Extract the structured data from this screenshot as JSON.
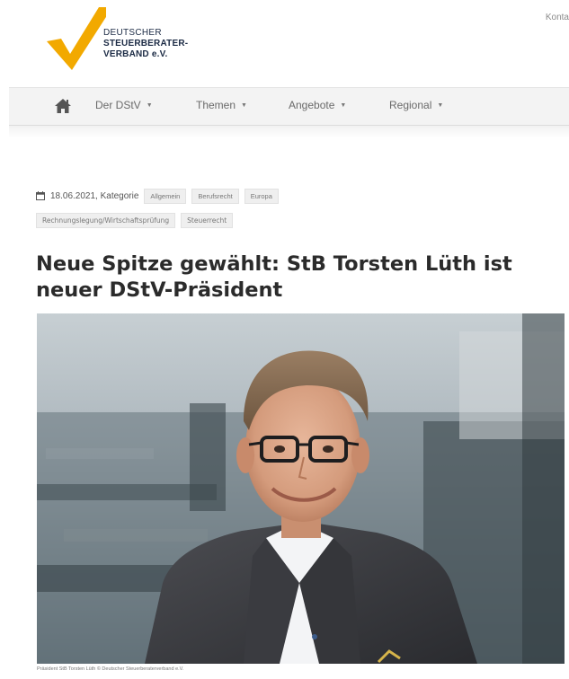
{
  "brand": {
    "logo_line1": "DEUTSCHER",
    "logo_line2": "STEUERBERATER-",
    "logo_line3": "VERBAND e.V.",
    "accent_color": "#f2a900",
    "text_color": "#1b2a44"
  },
  "top_link": "Konta",
  "nav": {
    "home_icon": "home-icon",
    "items": [
      {
        "label": "Der DStV"
      },
      {
        "label": "Themen"
      },
      {
        "label": "Angebote"
      },
      {
        "label": "Regional"
      }
    ]
  },
  "article": {
    "date": "18.06.2021, Kategorie",
    "tags_line1": [
      "Allgemein",
      "Berufsrecht",
      "Europa"
    ],
    "tags_line2": [
      "Rechnungslegung/Wirtschaftsprüfung",
      "Steuerrecht"
    ],
    "title": "Neue Spitze gewählt: StB Torsten Lüth ist neuer DStV-Präsident",
    "caption": "Präsident StB Torsten Lüth © Deutscher Steuerberaterverband e.V."
  }
}
